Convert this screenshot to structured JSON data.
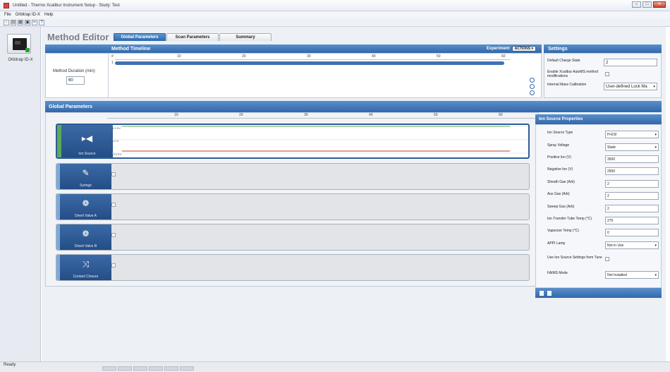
{
  "window": {
    "title": "Untitled - Thermo Xcalibur Instrument Setup - Study: Test",
    "min": "–",
    "max": "□",
    "close": "✕"
  },
  "menu": [
    "File",
    "Orbitrap ID-X",
    "Help"
  ],
  "toolbar": [
    "new",
    "open",
    "save",
    "print",
    "cut",
    "help"
  ],
  "toolbar_glyphs": [
    "▫",
    "▤",
    "▦",
    "▣",
    "✂",
    "?"
  ],
  "instrument": {
    "label": "Orbitrap ID-X"
  },
  "editor": {
    "title": "Method Editor",
    "tabs": [
      "Global Parameters",
      "Scan Parameters",
      "Summary"
    ]
  },
  "timeline": {
    "title": "Method Timeline",
    "experiment_label": "Experiment",
    "actions_label": "ACTIONS ▾",
    "duration_label": "Method Duration (min)",
    "duration_value": "60",
    "hash": "#",
    "row_num": "1",
    "ticks": [
      "10",
      "20",
      "30",
      "40",
      "50",
      "60"
    ]
  },
  "settings": {
    "title": "Settings",
    "rows": [
      {
        "label": "Default Charge State",
        "value": "2",
        "type": "input"
      },
      {
        "label": "Enable Xcalibur AutoMS method modifications",
        "value": "",
        "type": "checkbox"
      },
      {
        "label": "Internal Mass Calibration",
        "value": "User-defined Lock Ma",
        "type": "select"
      }
    ]
  },
  "global_params": {
    "title": "Global Parameters",
    "ticks": [
      "10",
      "20",
      "30",
      "40",
      "50",
      "60"
    ],
    "chart_ticks": [
      "3.0 KV",
      "0.0 V",
      "-3.0 KV"
    ],
    "devices": [
      {
        "label": "Ion Source",
        "glyph": "▸◀"
      },
      {
        "label": "Syringe",
        "glyph": "✎"
      },
      {
        "label": "Divert Valve A",
        "glyph": "❁"
      },
      {
        "label": "Divert Valve B",
        "glyph": "❁"
      },
      {
        "label": "Contact Closure",
        "glyph": "⤨"
      }
    ]
  },
  "ion_source": {
    "title": "Ion Source Properties",
    "rows": [
      {
        "label": "Ion Source Type",
        "value": "H-ESI",
        "type": "select"
      },
      {
        "label": "Spray Voltage",
        "value": "Static",
        "type": "select"
      },
      {
        "label": "Positive Ion (V)",
        "value": "3500",
        "type": "input"
      },
      {
        "label": "Negative Ion (V)",
        "value": "2500",
        "type": "input"
      },
      {
        "label": "Sheath Gas (Arb)",
        "value": "2",
        "type": "input"
      },
      {
        "label": "Aux Gas (Arb)",
        "value": "2",
        "type": "input"
      },
      {
        "label": "Sweep Gas (Arb)",
        "value": "2",
        "type": "input"
      },
      {
        "label": "Ion Transfer Tube Temp (°C)",
        "value": "275",
        "type": "input"
      },
      {
        "label": "Vaporizer Temp (°C)",
        "value": "0",
        "type": "input"
      },
      {
        "label": "APPI Lamp",
        "value": "Not in Use",
        "type": "select"
      },
      {
        "label": "Use Ion Source Settings from Tune",
        "value": "",
        "type": "checkbox"
      },
      {
        "label": "FAIMS Mode",
        "value": "Not Installed",
        "type": "select"
      }
    ]
  },
  "status": "Ready",
  "colors": {
    "accent_blue": "#3268ab",
    "ion_source_active": "#5bab57",
    "trace_red": "#c0392b"
  }
}
